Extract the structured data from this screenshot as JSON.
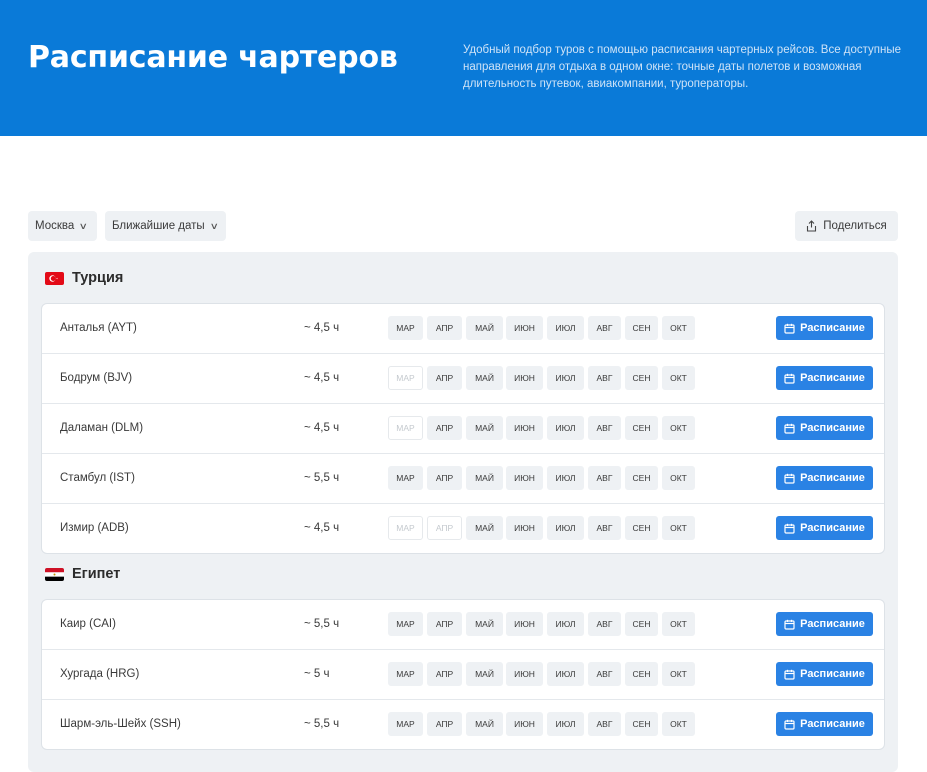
{
  "header": {
    "title": "Расписание чартеров",
    "description": "Удобный подбор туров с помощью расписания чартерных рейсов. Все доступные направления для отдыха в одном окне: точные даты полетов и возможная длительность путевок, авиакомпании, туроператоры."
  },
  "filters": {
    "city": "Москва",
    "dates": "Ближайшие даты",
    "share_label": "Поделиться"
  },
  "schedule_label": "Расписание",
  "months": [
    "МАР",
    "АПР",
    "МАЙ",
    "ИЮН",
    "ИЮЛ",
    "АВГ",
    "СЕН",
    "ОКТ"
  ],
  "countries": [
    {
      "name": "Турция",
      "flag": "turkey-flag-icon",
      "routes": [
        {
          "city": "Анталья (AYT)",
          "duration": "~ 4,5 ч",
          "available": [
            true,
            true,
            true,
            true,
            true,
            true,
            true,
            true
          ]
        },
        {
          "city": "Бодрум (BJV)",
          "duration": "~ 4,5 ч",
          "available": [
            false,
            true,
            true,
            true,
            true,
            true,
            true,
            true
          ]
        },
        {
          "city": "Даламан (DLM)",
          "duration": "~ 4,5 ч",
          "available": [
            false,
            true,
            true,
            true,
            true,
            true,
            true,
            true
          ]
        },
        {
          "city": "Стамбул (IST)",
          "duration": "~ 5,5 ч",
          "available": [
            true,
            true,
            true,
            true,
            true,
            true,
            true,
            true
          ]
        },
        {
          "city": "Измир (ADB)",
          "duration": "~ 4,5 ч",
          "available": [
            false,
            false,
            true,
            true,
            true,
            true,
            true,
            true
          ]
        }
      ]
    },
    {
      "name": "Египет",
      "flag": "egypt-flag-icon",
      "routes": [
        {
          "city": "Каир (CAI)",
          "duration": "~ 5,5 ч",
          "available": [
            true,
            true,
            true,
            true,
            true,
            true,
            true,
            true
          ]
        },
        {
          "city": "Хургада (HRG)",
          "duration": "~ 5 ч",
          "available": [
            true,
            true,
            true,
            true,
            true,
            true,
            true,
            true
          ]
        },
        {
          "city": "Шарм-эль-Шейх (SSH)",
          "duration": "~ 5,5 ч",
          "available": [
            true,
            true,
            true,
            true,
            true,
            true,
            true,
            true
          ]
        }
      ]
    }
  ],
  "colors": {
    "header_bg": "#0a7ad8",
    "button_bg": "#2a82e4",
    "panel_bg": "#eef1f4"
  }
}
